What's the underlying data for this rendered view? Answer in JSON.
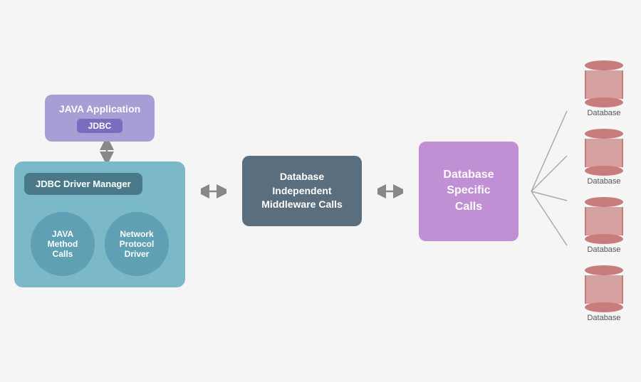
{
  "javaApp": {
    "title": "JAVA Application",
    "jdbc": "JDBC"
  },
  "jdbcManager": {
    "label": "JDBC Driver Manager"
  },
  "circles": {
    "java": "JAVA Method Calls",
    "network": "Network Protocol Driver"
  },
  "middleware": {
    "label": "Database Independent Middleware Calls"
  },
  "dbSpecific": {
    "label": "Database Specific Calls"
  },
  "databases": [
    {
      "label": "Database"
    },
    {
      "label": "Database"
    },
    {
      "label": "Database"
    },
    {
      "label": "Database"
    }
  ],
  "colors": {
    "javaBg": "#a89dd4",
    "jdbcBadge": "#7b6cbf",
    "outerBox": "#7bb8c8",
    "managerBox": "#4a7a8a",
    "circleBox": "#5fa0b4",
    "middlewareBox": "#5a6e7e",
    "dbSpecificBox": "#c08fd4",
    "cylinderTop": "#c97c7c",
    "cylinderBody": "#d4a0a0"
  }
}
